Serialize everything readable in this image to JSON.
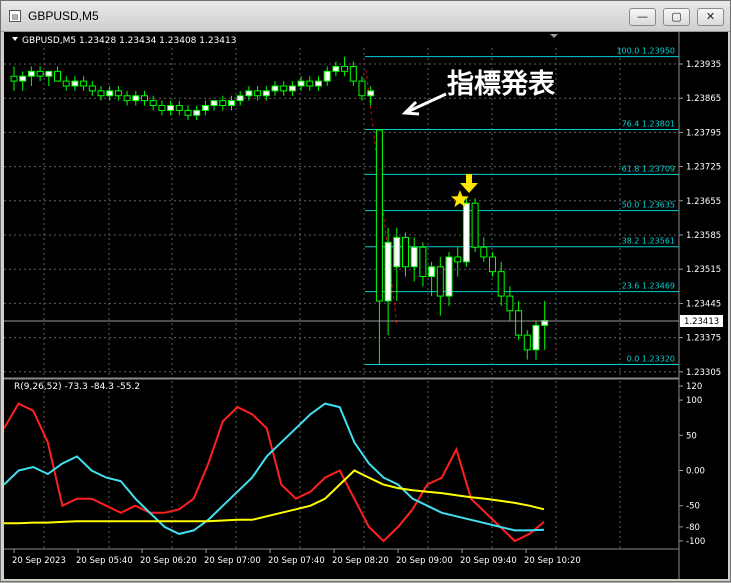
{
  "window": {
    "title": "GBPUSD,M5",
    "buttons": [
      "minimize",
      "maximize",
      "close"
    ]
  },
  "chart_header": "GBPUSD,M5  1.23428 1.23434 1.23408 1.23413",
  "annotation": {
    "text": "指標発表"
  },
  "colors": {
    "background": "#000000",
    "bull": "#00FF00",
    "bear_body": "#000000",
    "fib": "#00D0D0",
    "red": "#FF2020",
    "cyan": "#40E0F0",
    "yellow": "#FFFF00",
    "grid": "#606060",
    "marker": "#FFEE00"
  },
  "price_axis": {
    "labels": [
      "1.23935",
      "1.23865",
      "1.23795",
      "1.23725",
      "1.23655",
      "1.23585",
      "1.23515",
      "1.23445",
      "1.23375",
      "1.23305"
    ],
    "current_price": "1.23413"
  },
  "fibonacci": [
    {
      "label": "100.0  1.23950",
      "price": 1.2395
    },
    {
      "label": "76.4  1.23801",
      "price": 1.23801
    },
    {
      "label": "61.8  1.23709",
      "price": 1.23709
    },
    {
      "label": "50.0  1.23635",
      "price": 1.23635
    },
    {
      "label": "38.2  1.23561",
      "price": 1.23561
    },
    {
      "label": "23.6  1.23469",
      "price": 1.23469
    },
    {
      "label": "0.0  1.23320",
      "price": 1.2332
    }
  ],
  "indicator": {
    "header": "R(9,26,52) -73.3 -84.3 -55.2",
    "axis_labels": [
      "120",
      "100",
      "50",
      "0.00",
      "-50",
      "-80",
      "-100"
    ]
  },
  "time_axis": [
    "20 Sep 2023",
    "20 Sep 05:40",
    "20 Sep 06:20",
    "20 Sep 07:00",
    "20 Sep 07:40",
    "20 Sep 08:20",
    "20 Sep 09:00",
    "20 Sep 09:40",
    "20 Sep 10:20"
  ],
  "chart_data": [
    {
      "type": "candlestick",
      "title": "GBPUSD,M5",
      "ylim": [
        1.2328,
        1.2398
      ],
      "candles": [
        {
          "o": 1.2391,
          "h": 1.2393,
          "l": 1.2388,
          "c": 1.239
        },
        {
          "o": 1.239,
          "h": 1.2392,
          "l": 1.2388,
          "c": 1.2391
        },
        {
          "o": 1.2391,
          "h": 1.2393,
          "l": 1.2389,
          "c": 1.2392
        },
        {
          "o": 1.2392,
          "h": 1.2393,
          "l": 1.239,
          "c": 1.2391
        },
        {
          "o": 1.2391,
          "h": 1.2392,
          "l": 1.2389,
          "c": 1.2392
        },
        {
          "o": 1.2392,
          "h": 1.2393,
          "l": 1.239,
          "c": 1.239
        },
        {
          "o": 1.239,
          "h": 1.2391,
          "l": 1.2388,
          "c": 1.2389
        },
        {
          "o": 1.2389,
          "h": 1.2391,
          "l": 1.2388,
          "c": 1.239
        },
        {
          "o": 1.239,
          "h": 1.2391,
          "l": 1.2388,
          "c": 1.2389
        },
        {
          "o": 1.2389,
          "h": 1.239,
          "l": 1.2387,
          "c": 1.2388
        },
        {
          "o": 1.2388,
          "h": 1.2389,
          "l": 1.2386,
          "c": 1.2387
        },
        {
          "o": 1.2387,
          "h": 1.2389,
          "l": 1.2386,
          "c": 1.2388
        },
        {
          "o": 1.2388,
          "h": 1.2389,
          "l": 1.2386,
          "c": 1.2387
        },
        {
          "o": 1.2387,
          "h": 1.2388,
          "l": 1.2385,
          "c": 1.2386
        },
        {
          "o": 1.2386,
          "h": 1.2388,
          "l": 1.2385,
          "c": 1.2387
        },
        {
          "o": 1.2387,
          "h": 1.2388,
          "l": 1.2385,
          "c": 1.2386
        },
        {
          "o": 1.2386,
          "h": 1.2387,
          "l": 1.2384,
          "c": 1.2385
        },
        {
          "o": 1.2385,
          "h": 1.2386,
          "l": 1.2383,
          "c": 1.2384
        },
        {
          "o": 1.2384,
          "h": 1.2386,
          "l": 1.2383,
          "c": 1.2385
        },
        {
          "o": 1.2385,
          "h": 1.2386,
          "l": 1.2383,
          "c": 1.2384
        },
        {
          "o": 1.2384,
          "h": 1.2385,
          "l": 1.2382,
          "c": 1.2383
        },
        {
          "o": 1.2383,
          "h": 1.2385,
          "l": 1.2382,
          "c": 1.2384
        },
        {
          "o": 1.2384,
          "h": 1.2386,
          "l": 1.2383,
          "c": 1.2385
        },
        {
          "o": 1.2385,
          "h": 1.2386,
          "l": 1.2384,
          "c": 1.2386
        },
        {
          "o": 1.2386,
          "h": 1.2387,
          "l": 1.2384,
          "c": 1.2385
        },
        {
          "o": 1.2385,
          "h": 1.2387,
          "l": 1.2384,
          "c": 1.2386
        },
        {
          "o": 1.2386,
          "h": 1.2388,
          "l": 1.2385,
          "c": 1.2387
        },
        {
          "o": 1.2387,
          "h": 1.2389,
          "l": 1.2386,
          "c": 1.2388
        },
        {
          "o": 1.2388,
          "h": 1.2389,
          "l": 1.2386,
          "c": 1.2387
        },
        {
          "o": 1.2387,
          "h": 1.2389,
          "l": 1.2386,
          "c": 1.2388
        },
        {
          "o": 1.2388,
          "h": 1.239,
          "l": 1.2387,
          "c": 1.2389
        },
        {
          "o": 1.2389,
          "h": 1.239,
          "l": 1.2387,
          "c": 1.2388
        },
        {
          "o": 1.2388,
          "h": 1.239,
          "l": 1.2387,
          "c": 1.2389
        },
        {
          "o": 1.2389,
          "h": 1.2391,
          "l": 1.2388,
          "c": 1.239
        },
        {
          "o": 1.239,
          "h": 1.2391,
          "l": 1.2388,
          "c": 1.2389
        },
        {
          "o": 1.2389,
          "h": 1.2391,
          "l": 1.2388,
          "c": 1.239
        },
        {
          "o": 1.239,
          "h": 1.2393,
          "l": 1.2389,
          "c": 1.2392
        },
        {
          "o": 1.2392,
          "h": 1.2394,
          "l": 1.2391,
          "c": 1.2393
        },
        {
          "o": 1.2393,
          "h": 1.2395,
          "l": 1.2391,
          "c": 1.2392
        },
        {
          "o": 1.2393,
          "h": 1.2394,
          "l": 1.2389,
          "c": 1.239
        },
        {
          "o": 1.239,
          "h": 1.2391,
          "l": 1.2386,
          "c": 1.2387
        },
        {
          "o": 1.2387,
          "h": 1.2389,
          "l": 1.2385,
          "c": 1.2388
        },
        {
          "o": 1.238,
          "h": 1.238,
          "l": 1.2332,
          "c": 1.2345
        },
        {
          "o": 1.2345,
          "h": 1.236,
          "l": 1.2338,
          "c": 1.2357
        },
        {
          "o": 1.2352,
          "h": 1.236,
          "l": 1.2345,
          "c": 1.2358
        },
        {
          "o": 1.2358,
          "h": 1.2359,
          "l": 1.235,
          "c": 1.2352
        },
        {
          "o": 1.2352,
          "h": 1.2358,
          "l": 1.2349,
          "c": 1.2356
        },
        {
          "o": 1.2356,
          "h": 1.2357,
          "l": 1.2348,
          "c": 1.235
        },
        {
          "o": 1.235,
          "h": 1.2353,
          "l": 1.2346,
          "c": 1.2352
        },
        {
          "o": 1.2352,
          "h": 1.2354,
          "l": 1.2342,
          "c": 1.2346
        },
        {
          "o": 1.2346,
          "h": 1.2355,
          "l": 1.2344,
          "c": 1.2354
        },
        {
          "o": 1.2354,
          "h": 1.2356,
          "l": 1.235,
          "c": 1.2353
        },
        {
          "o": 1.2353,
          "h": 1.2366,
          "l": 1.2352,
          "c": 1.2365
        },
        {
          "o": 1.2365,
          "h": 1.2366,
          "l": 1.2355,
          "c": 1.2356
        },
        {
          "o": 1.2356,
          "h": 1.2358,
          "l": 1.2353,
          "c": 1.2354
        },
        {
          "o": 1.2354,
          "h": 1.2355,
          "l": 1.235,
          "c": 1.2351
        },
        {
          "o": 1.2351,
          "h": 1.2353,
          "l": 1.2344,
          "c": 1.2346
        },
        {
          "o": 1.2346,
          "h": 1.2348,
          "l": 1.2341,
          "c": 1.2343
        },
        {
          "o": 1.2343,
          "h": 1.2345,
          "l": 1.2337,
          "c": 1.2338
        },
        {
          "o": 1.2338,
          "h": 1.2339,
          "l": 1.2333,
          "c": 1.2335
        },
        {
          "o": 1.2335,
          "h": 1.2341,
          "l": 1.2333,
          "c": 1.234
        },
        {
          "o": 1.234,
          "h": 1.2345,
          "l": 1.2335,
          "c": 1.2341
        }
      ]
    },
    {
      "type": "line",
      "title": "R(9,26,52)",
      "ylim": [
        -110,
        120
      ],
      "series": [
        {
          "name": "R 9",
          "values": [
            60,
            95,
            85,
            40,
            -50,
            -40,
            -40,
            -50,
            -60,
            -50,
            -60,
            -60,
            -55,
            -40,
            10,
            70,
            90,
            80,
            60,
            -20,
            -40,
            -30,
            -10,
            0,
            -40,
            -80,
            -100,
            -80,
            -55,
            -20,
            -10,
            30,
            -40,
            -60,
            -80,
            -100,
            -90,
            -73
          ]
        },
        {
          "name": "R 26",
          "values": [
            -20,
            0,
            5,
            -5,
            10,
            20,
            0,
            -10,
            -15,
            -40,
            -60,
            -80,
            -90,
            -85,
            -70,
            -50,
            -30,
            -10,
            20,
            40,
            60,
            80,
            95,
            90,
            40,
            10,
            -10,
            -20,
            -40,
            -50,
            -60,
            -65,
            -70,
            -75,
            -80,
            -85,
            -85,
            -84
          ]
        },
        {
          "name": "R 52",
          "values": [
            -75,
            -75,
            -74,
            -74,
            -73,
            -72,
            -72,
            -72,
            -72,
            -72,
            -72,
            -72,
            -72,
            -72,
            -72,
            -71,
            -70,
            -70,
            -65,
            -60,
            -55,
            -50,
            -40,
            -20,
            0,
            -10,
            -20,
            -25,
            -28,
            -30,
            -32,
            -35,
            -38,
            -40,
            -43,
            -46,
            -50,
            -55
          ]
        }
      ]
    }
  ]
}
